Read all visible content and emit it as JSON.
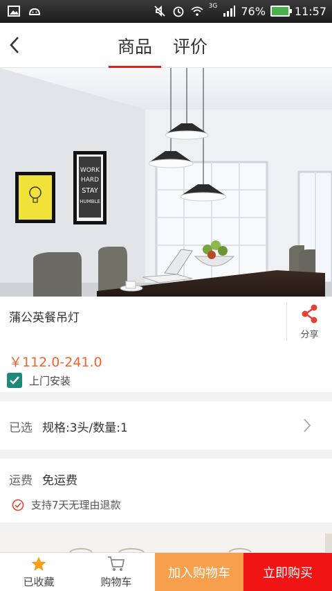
{
  "status_bar": {
    "battery": "76%",
    "time": "11:57",
    "network": "3G"
  },
  "header": {
    "tabs": [
      {
        "label": "商品",
        "active": true
      },
      {
        "label": "评价",
        "active": false
      }
    ]
  },
  "hero": {
    "poster_text": [
      "WORK",
      "HARD",
      "STAY",
      "HUMBLE"
    ]
  },
  "product": {
    "title": "蒲公英餐吊灯",
    "share_label": "分享",
    "price": "￥112.0-241.0",
    "install_label": "上门安装",
    "install_checked": true
  },
  "spec": {
    "key": "已选",
    "value": "规格:3头/数量:1"
  },
  "shipping": {
    "key": "运费",
    "value": "免运费",
    "return_policy": "支持7天无理由退款"
  },
  "bottom_bar": {
    "favorite_label": "已收藏",
    "cart_label": "购物车",
    "add_to_cart_label": "加入购物车",
    "buy_now_label": "立即购买"
  },
  "colors": {
    "accent_red": "#f01414",
    "orange": "#f6a04d",
    "price": "#f0642d",
    "check_teal": "#1c8a7a"
  }
}
